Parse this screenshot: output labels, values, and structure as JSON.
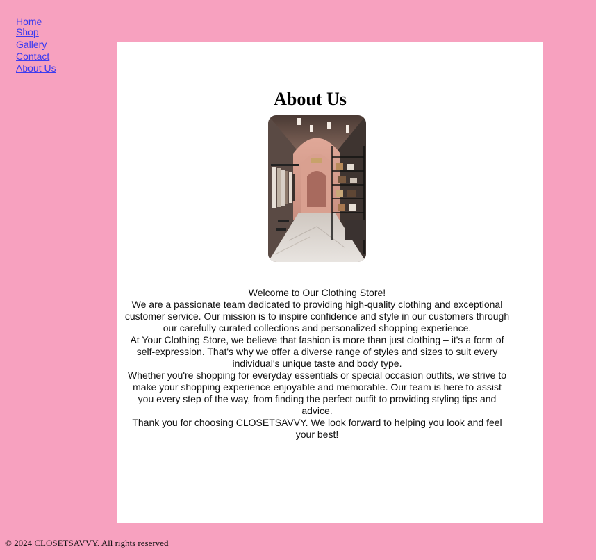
{
  "nav": {
    "items": [
      {
        "label": "Home"
      },
      {
        "label": "Shop"
      },
      {
        "label": "Gallery"
      },
      {
        "label": "Contact"
      },
      {
        "label": "About Us"
      }
    ]
  },
  "main": {
    "title": "About Us",
    "paragraphs": [
      "Welcome to Our Clothing Store!",
      "We are a passionate team dedicated to providing high-quality clothing and exceptional customer service. Our mission is to inspire confidence and style in our customers through our carefully curated collections and personalized shopping experience.",
      "At Your Clothing Store, we believe that fashion is more than just clothing – it's a form of self-expression. That's why we offer a diverse range of styles and sizes to suit every individual's unique taste and body type.",
      "Whether you're shopping for everyday essentials or special occasion outfits, we strive to make your shopping experience enjoyable and memorable. Our team is here to assist you every step of the way, from finding the perfect outfit to providing styling tips and advice.",
      "Thank you for choosing CLOSETSAVVY. We look forward to helping you look and feel your best!"
    ]
  },
  "footer": {
    "text": "© 2024 CLOSETSAVVY. All rights reserved"
  },
  "colors": {
    "background": "#f7a1bf",
    "card": "#ffffff",
    "link": "#3b3bf0"
  }
}
